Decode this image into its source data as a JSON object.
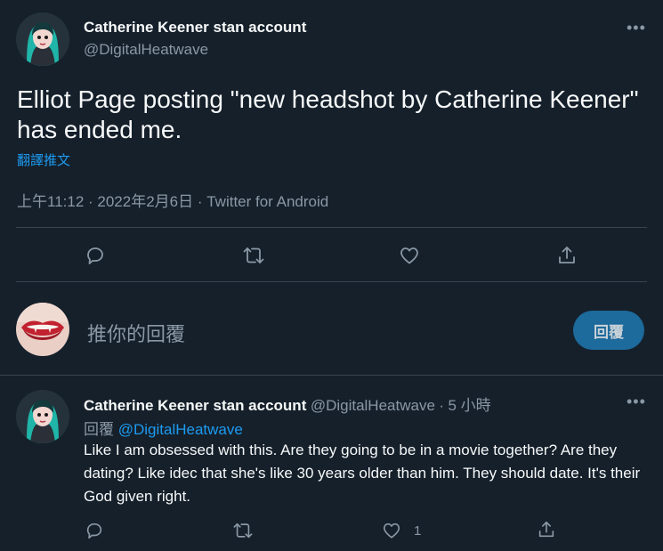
{
  "main_tweet": {
    "display_name": "Catherine Keener stan account",
    "handle": "@DigitalHeatwave",
    "more_icon": "more-horizontal-icon",
    "text": "Elliot Page posting \"new headshot by Catherine Keener\" has ended me.",
    "translate_label": "翻譯推文",
    "timestamp": "上午11:12 · 2022年2月6日 · Twitter for Android",
    "actions": [
      "reply-icon",
      "retweet-icon",
      "like-icon",
      "share-icon"
    ]
  },
  "compose": {
    "placeholder": "推你的回覆",
    "button_label": "回覆",
    "button_color": "#1d6a9c"
  },
  "reply_tweet": {
    "display_name": "Catherine Keener stan account",
    "handle": "@DigitalHeatwave",
    "separator": "·",
    "time": "5 小時",
    "replying_prefix": "回覆",
    "replying_to": "@DigitalHeatwave",
    "text": "Like I am obsessed with this. Are they going to be in a movie together? Are they dating? Like idec that she's like 30 years older than him. They should date. It's their God given right.",
    "like_count": "1"
  },
  "colors": {
    "background": "#15202b",
    "accent": "#1d9bf0",
    "secondary_text": "#8b98a5",
    "divider": "#38444d"
  }
}
